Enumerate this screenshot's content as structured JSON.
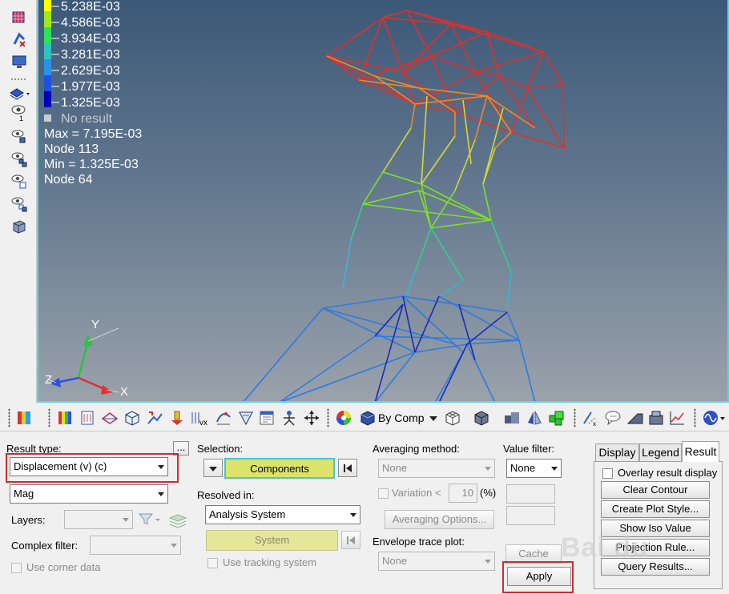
{
  "legend": {
    "values": [
      "5.238E-03",
      "4.586E-03",
      "3.934E-03",
      "3.281E-03",
      "2.629E-03",
      "1.977E-03",
      "1.325E-03"
    ],
    "colors": [
      "#ffff00",
      "#9fe81e",
      "#2ee05a",
      "#2ec2c2",
      "#2c8fe8",
      "#2050e0",
      "#0000b8"
    ],
    "no_result": "No result",
    "max_text": "Max = 7.195E-03",
    "max_node": "Node 113",
    "min_text": "Min = 1.325E-03",
    "min_node": "Node 64"
  },
  "axes": {
    "y": "Y",
    "z": "Z",
    "x": "X"
  },
  "toolbar": {
    "by_comp_label": "By Comp"
  },
  "panel": {
    "result_type_label": "Result type:",
    "result_type_value": "Displacement (v) (c)",
    "component_value": "Mag",
    "layers_label": "Layers:",
    "complex_filter_label": "Complex filter:",
    "use_corner_data_label": "Use corner data",
    "selection_label": "Selection:",
    "components_button": "Components",
    "resolved_in_label": "Resolved in:",
    "resolved_in_value": "Analysis System",
    "system_button": "System",
    "use_tracking_label": "Use tracking system",
    "averaging_method_label": "Averaging method:",
    "averaging_method_value": "None",
    "variation_label": "Variation <",
    "variation_value": "10",
    "variation_unit": "(%)",
    "averaging_options_button": "Averaging Options...",
    "envelope_label": "Envelope trace plot:",
    "envelope_value": "None",
    "value_filter_label": "Value filter:",
    "value_filter_value": "None",
    "cache_button": "Cache",
    "apply_button": "Apply",
    "more_button": "..."
  },
  "tabs": {
    "display": "Display",
    "legend": "Legend",
    "result": "Result"
  },
  "result_tab": {
    "overlay_label": "Overlay result display",
    "clear_contour": "Clear Contour",
    "create_plot_style": "Create Plot Style...",
    "show_iso_value": "Show Iso Value",
    "projection_rule": "Projection Rule...",
    "query_results": "Query Results..."
  },
  "watermark": "Bai du"
}
